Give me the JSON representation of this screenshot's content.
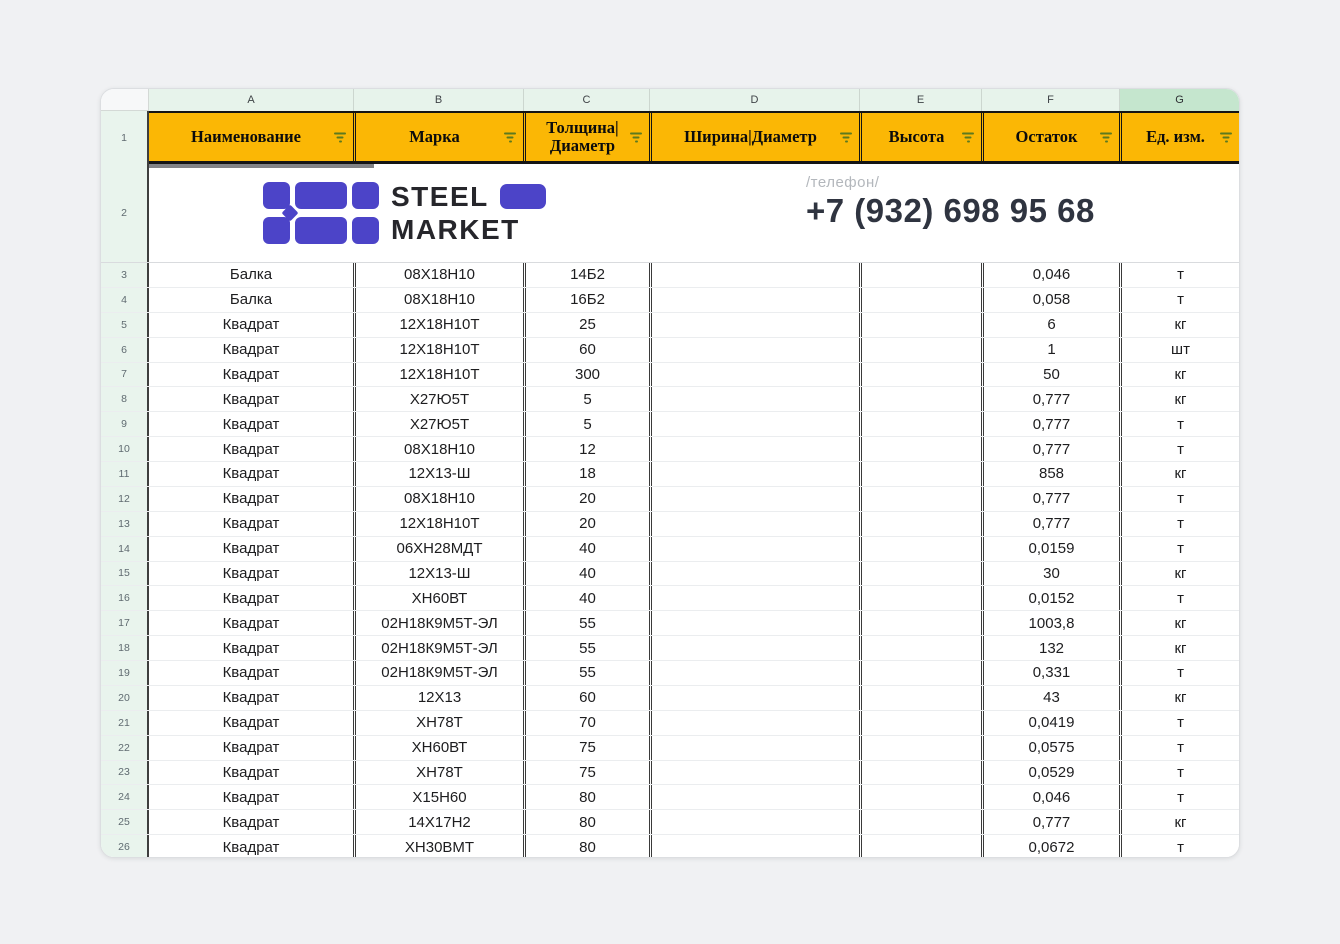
{
  "app": {
    "background": "#F0F1F3"
  },
  "spreadsheet": {
    "column_letters": [
      "A",
      "B",
      "C",
      "D",
      "E",
      "F",
      "G"
    ],
    "selected_column_letter": "G",
    "row1_number": "1",
    "row2_number": "2",
    "headers": [
      {
        "label": "Наименование"
      },
      {
        "label": "Марка"
      },
      {
        "label": "Толщина|",
        "label2": "Диаметр"
      },
      {
        "label": "Ширина|Диаметр"
      },
      {
        "label": "Высота"
      },
      {
        "label": "Остаток"
      },
      {
        "label": "Ед. изм."
      }
    ],
    "banner": {
      "logo_word1": "STEEL",
      "logo_word2": "MARKET",
      "phone_label": "/телефон/",
      "phone_number": "+7 (932) 698 95 68"
    },
    "colors": {
      "header_fill": "#FBB705",
      "logo_purple": "#4C44C8",
      "filter_icon_green": "#5E7A1E",
      "letters_fill": "#E7F3EB",
      "selected_letter_fill": "#C5E6CE",
      "phone_text": "#2F3440"
    },
    "rows": [
      {
        "n": "3",
        "name": "Балка",
        "grade": "08Х18Н10",
        "thickness": "14Б2",
        "width": "",
        "height": "",
        "stock": "0,046",
        "unit": "т"
      },
      {
        "n": "4",
        "name": "Балка",
        "grade": "08Х18Н10",
        "thickness": "16Б2",
        "width": "",
        "height": "",
        "stock": "0,058",
        "unit": "т"
      },
      {
        "n": "5",
        "name": "Квадрат",
        "grade": "12Х18Н10Т",
        "thickness": "25",
        "width": "",
        "height": "",
        "stock": "6",
        "unit": "кг"
      },
      {
        "n": "6",
        "name": "Квадрат",
        "grade": "12Х18Н10Т",
        "thickness": "60",
        "width": "",
        "height": "",
        "stock": "1",
        "unit": "шт"
      },
      {
        "n": "7",
        "name": "Квадрат",
        "grade": "12Х18Н10Т",
        "thickness": "300",
        "width": "",
        "height": "",
        "stock": "50",
        "unit": "кг"
      },
      {
        "n": "8",
        "name": "Квадрат",
        "grade": "Х27Ю5Т",
        "thickness": "5",
        "width": "",
        "height": "",
        "stock": "0,777",
        "unit": "кг"
      },
      {
        "n": "9",
        "name": "Квадрат",
        "grade": "Х27Ю5Т",
        "thickness": "5",
        "width": "",
        "height": "",
        "stock": "0,777",
        "unit": "т"
      },
      {
        "n": "10",
        "name": "Квадрат",
        "grade": "08Х18Н10",
        "thickness": "12",
        "width": "",
        "height": "",
        "stock": "0,777",
        "unit": "т"
      },
      {
        "n": "11",
        "name": "Квадрат",
        "grade": "12Х13-Ш",
        "thickness": "18",
        "width": "",
        "height": "",
        "stock": "858",
        "unit": "кг"
      },
      {
        "n": "12",
        "name": "Квадрат",
        "grade": "08Х18Н10",
        "thickness": "20",
        "width": "",
        "height": "",
        "stock": "0,777",
        "unit": "т"
      },
      {
        "n": "13",
        "name": "Квадрат",
        "grade": "12Х18Н10Т",
        "thickness": "20",
        "width": "",
        "height": "",
        "stock": "0,777",
        "unit": "т"
      },
      {
        "n": "14",
        "name": "Квадрат",
        "grade": "06ХН28МДТ",
        "thickness": "40",
        "width": "",
        "height": "",
        "stock": "0,0159",
        "unit": "т"
      },
      {
        "n": "15",
        "name": "Квадрат",
        "grade": "12Х13-Ш",
        "thickness": "40",
        "width": "",
        "height": "",
        "stock": "30",
        "unit": "кг"
      },
      {
        "n": "16",
        "name": "Квадрат",
        "grade": "ХН60ВТ",
        "thickness": "40",
        "width": "",
        "height": "",
        "stock": "0,0152",
        "unit": "т"
      },
      {
        "n": "17",
        "name": "Квадрат",
        "grade": "02Н18К9М5Т-ЭЛ",
        "thickness": "55",
        "width": "",
        "height": "",
        "stock": "1003,8",
        "unit": "кг"
      },
      {
        "n": "18",
        "name": "Квадрат",
        "grade": "02Н18К9М5Т-ЭЛ",
        "thickness": "55",
        "width": "",
        "height": "",
        "stock": "132",
        "unit": "кг"
      },
      {
        "n": "19",
        "name": "Квадрат",
        "grade": "02Н18К9М5Т-ЭЛ",
        "thickness": "55",
        "width": "",
        "height": "",
        "stock": "0,331",
        "unit": "т"
      },
      {
        "n": "20",
        "name": "Квадрат",
        "grade": "12Х13",
        "thickness": "60",
        "width": "",
        "height": "",
        "stock": "43",
        "unit": "кг"
      },
      {
        "n": "21",
        "name": "Квадрат",
        "grade": "ХН78Т",
        "thickness": "70",
        "width": "",
        "height": "",
        "stock": "0,0419",
        "unit": "т"
      },
      {
        "n": "22",
        "name": "Квадрат",
        "grade": "ХН60ВТ",
        "thickness": "75",
        "width": "",
        "height": "",
        "stock": "0,0575",
        "unit": "т"
      },
      {
        "n": "23",
        "name": "Квадрат",
        "grade": "ХН78Т",
        "thickness": "75",
        "width": "",
        "height": "",
        "stock": "0,0529",
        "unit": "т"
      },
      {
        "n": "24",
        "name": "Квадрат",
        "grade": "Х15Н60",
        "thickness": "80",
        "width": "",
        "height": "",
        "stock": "0,046",
        "unit": "т"
      },
      {
        "n": "25",
        "name": "Квадрат",
        "grade": "14Х17Н2",
        "thickness": "80",
        "width": "",
        "height": "",
        "stock": "0,777",
        "unit": "кг"
      },
      {
        "n": "26",
        "name": "Квадрат",
        "grade": "ХН30ВМТ",
        "thickness": "80",
        "width": "",
        "height": "",
        "stock": "0,0672",
        "unit": "т"
      }
    ]
  }
}
